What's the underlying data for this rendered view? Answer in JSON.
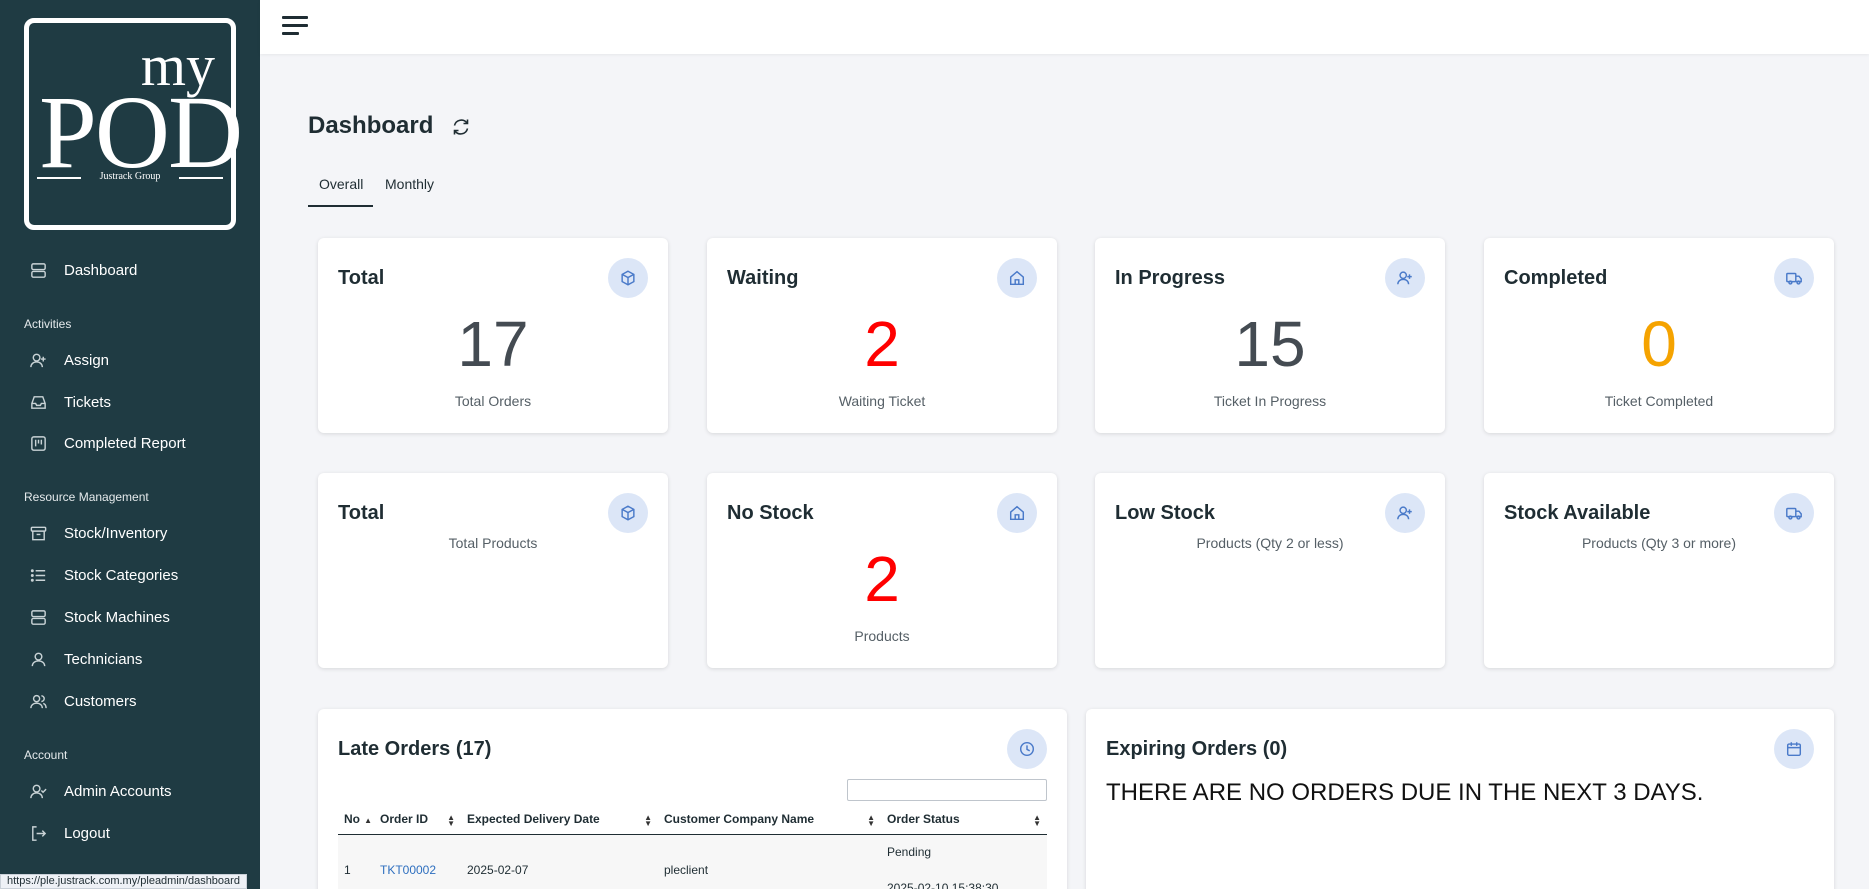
{
  "logo": {
    "my": "my",
    "pod": "POD",
    "sub": "Justrack Group"
  },
  "sidebar": {
    "dashboard": "Dashboard",
    "sections": {
      "activities": "Activities",
      "resource": "Resource Management",
      "account": "Account"
    },
    "items": {
      "assign": "Assign",
      "tickets": "Tickets",
      "completed_report": "Completed Report",
      "stock_inventory": "Stock/Inventory",
      "stock_categories": "Stock Categories",
      "stock_machines": "Stock Machines",
      "technicians": "Technicians",
      "customers": "Customers",
      "admin_accounts": "Admin Accounts",
      "logout": "Logout"
    }
  },
  "status_url": "https://ple.justrack.com.my/pleadmin/dashboard",
  "header": {
    "title": "Dashboard",
    "tabs": [
      "Overall",
      "Monthly"
    ],
    "active_tab": "Overall"
  },
  "orders": [
    {
      "title": "Total",
      "value": "17",
      "caption": "Total Orders",
      "color": "#444b52",
      "icon": "cube-icon"
    },
    {
      "title": "Waiting",
      "value": "2",
      "caption": "Waiting Ticket",
      "color": "#ff0000",
      "icon": "home-icon"
    },
    {
      "title": "In Progress",
      "value": "15",
      "caption": "Ticket In Progress",
      "color": "#444b52",
      "icon": "user-plus-icon"
    },
    {
      "title": "Completed",
      "value": "0",
      "caption": "Ticket Completed",
      "color": "#f5a300",
      "icon": "truck-icon"
    }
  ],
  "stock": [
    {
      "title": "Total",
      "caption": "Total Products",
      "icon": "cube-icon"
    },
    {
      "title": "No Stock",
      "value": "2",
      "caption": "Products",
      "color": "#ff0000",
      "icon": "home-icon"
    },
    {
      "title": "Low Stock",
      "caption": "Products (Qty 2 or less)",
      "icon": "user-plus-icon"
    },
    {
      "title": "Stock Available",
      "caption": "Products (Qty 3 or more)",
      "icon": "truck-icon"
    }
  ],
  "late_orders": {
    "title": "Late Orders (17)",
    "columns": [
      "No",
      "Order ID",
      "Expected Delivery Date",
      "Customer Company Name",
      "Order Status"
    ],
    "rows": [
      {
        "no": "1",
        "order_id": "TKT00002",
        "date": "2025-02-07",
        "customer": "pleclient",
        "status": "Pending",
        "status_time": "2025-02-10 15:38:30"
      }
    ]
  },
  "expiring_orders": {
    "title": "Expiring Orders (0)",
    "message": "THERE ARE NO ORDERS DUE IN THE NEXT 3 DAYS."
  }
}
